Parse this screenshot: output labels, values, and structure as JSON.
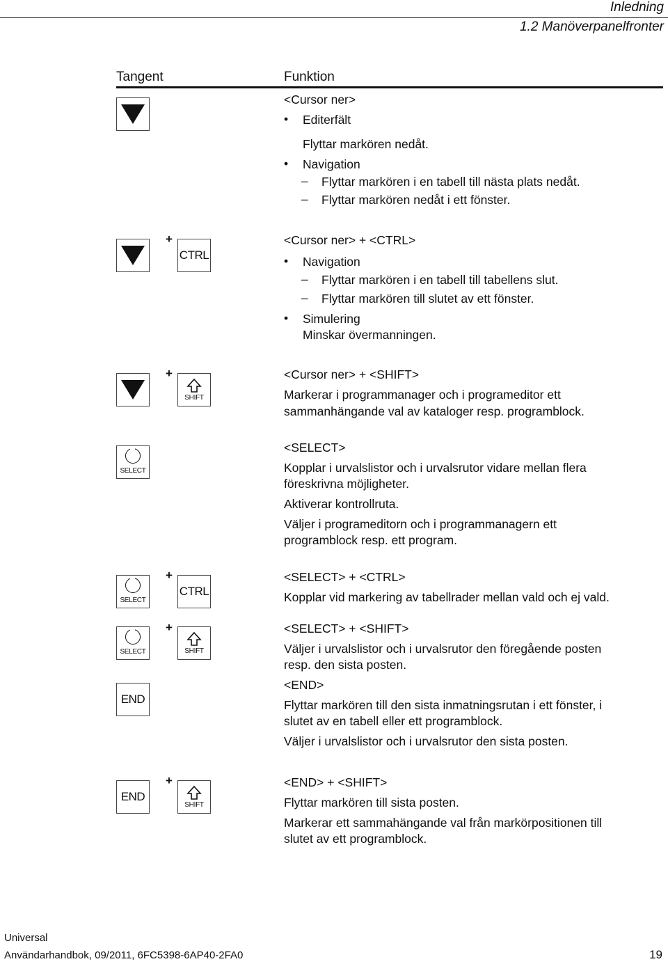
{
  "header": {
    "chapter": "Inledning",
    "section": "1.2 Manöverpanelfronter"
  },
  "table": {
    "col_key": "Tangent",
    "col_function": "Funktion",
    "plus": "+",
    "keys": {
      "ctrl": "CTRL",
      "shift": "SHIFT",
      "select": "SELECT",
      "end": "END"
    },
    "rows": [
      {
        "title": "<Cursor ner>",
        "bullet1": "Editerfält",
        "bullet1_text": "Flyttar markören nedåt.",
        "bullet2": "Navigation",
        "dash1": "Flyttar markören i en tabell till nästa plats nedåt.",
        "dash2": "Flyttar markören nedåt i ett fönster."
      },
      {
        "title": "<Cursor ner> + <CTRL>",
        "bullet1": "Navigation",
        "dash1": "Flyttar markören i en tabell till tabellens slut.",
        "dash2": "Flyttar markören till slutet av ett fönster.",
        "bullet2": "Simulering",
        "bullet2_text": "Minskar övermanningen."
      },
      {
        "title": "<Cursor ner> + <SHIFT>",
        "line1": "Markerar i programmanager och i programeditor ett",
        "line2": "sammanhängande val av kataloger resp. programblock."
      },
      {
        "title": "<SELECT>",
        "line1": "Kopplar i urvalslistor och i urvalsrutor vidare mellan flera",
        "line2": "föreskrivna möjligheter.",
        "line3": "Aktiverar kontrollruta.",
        "line4": "Väljer i programeditorn och i programmanagern ett",
        "line5": "programblock resp. ett program."
      },
      {
        "title": "<SELECT> + <CTRL>",
        "line1": "Kopplar vid markering av tabellrader mellan vald och ej vald."
      },
      {
        "title": "<SELECT> + <SHIFT>",
        "line1": "Väljer i urvalslistor och i urvalsrutor den föregående posten",
        "line2": "resp. den sista posten."
      },
      {
        "title": "<END>",
        "line1": "Flyttar markören till den sista inmatningsrutan i ett fönster, i",
        "line2": "slutet av en tabell eller ett programblock.",
        "line3": "Väljer i urvalslistor och i urvalsrutor den sista posten."
      },
      {
        "title": "<END> + <SHIFT>",
        "line1": "Flyttar markören till sista posten.",
        "line2": "Markerar ett sammahängande val från markörpositionen till",
        "line3": "slutet av ett programblock."
      }
    ]
  },
  "footer": {
    "product": "Universal",
    "doc": "Användarhandbok, 09/2011, 6FC5398-6AP40-2FA0",
    "page": "19"
  }
}
